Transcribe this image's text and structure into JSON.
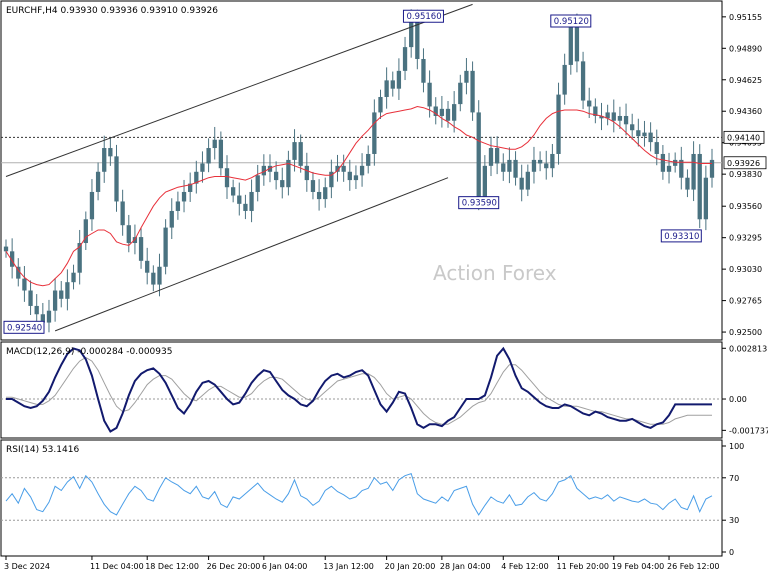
{
  "chart_data": {
    "type": "candlestick",
    "symbol_header": "EURCHF,H4  0.93930 0.93936 0.93910 0.93926",
    "watermark": "Action Forex",
    "current_price_label": "0.93926",
    "resistance_label": "0.94140",
    "price_axis": {
      "ylim": [
        0.9245,
        0.9528
      ],
      "ticks": [
        "0.95155",
        "0.94890",
        "0.94625",
        "0.94360",
        "0.94095",
        "0.93830",
        "0.93560",
        "0.93295",
        "0.93030",
        "0.92765",
        "0.92500"
      ]
    },
    "price_annotations": [
      {
        "label": "0.92540",
        "x": 1,
        "y": 0.9254
      },
      {
        "label": "0.95160",
        "x": 68,
        "y": 0.9516
      },
      {
        "label": "0.93590",
        "x": 77,
        "y": 0.9359
      },
      {
        "label": "0.95120",
        "x": 92,
        "y": 0.9512
      },
      {
        "label": "0.93310",
        "x": 110,
        "y": 0.9331
      }
    ],
    "channel": [
      {
        "name": "upper",
        "from": [
          0,
          0.9381
        ],
        "to": [
          76,
          0.9526
        ]
      },
      {
        "name": "lower",
        "from": [
          8,
          0.9251
        ],
        "to": [
          72,
          0.938
        ]
      }
    ],
    "closes": [
      0.9318,
      0.9305,
      0.9295,
      0.9285,
      0.9272,
      0.9265,
      0.9258,
      0.9268,
      0.9285,
      0.9278,
      0.9292,
      0.93,
      0.9325,
      0.9345,
      0.9368,
      0.9385,
      0.9405,
      0.9398,
      0.936,
      0.934,
      0.9325,
      0.933,
      0.931,
      0.93,
      0.929,
      0.9305,
      0.9338,
      0.9352,
      0.936,
      0.9368,
      0.9375,
      0.9385,
      0.9392,
      0.9405,
      0.9412,
      0.9388,
      0.9372,
      0.9365,
      0.9358,
      0.9352,
      0.9368,
      0.9382,
      0.939,
      0.9385,
      0.9378,
      0.9372,
      0.9395,
      0.941,
      0.939,
      0.9378,
      0.9368,
      0.9362,
      0.9372,
      0.9385,
      0.939,
      0.9385,
      0.9378,
      0.9382,
      0.939,
      0.94,
      0.9435,
      0.9448,
      0.9462,
      0.9455,
      0.947,
      0.949,
      0.9512,
      0.948,
      0.946,
      0.944,
      0.9432,
      0.9438,
      0.9428,
      0.9442,
      0.946,
      0.947,
      0.9435,
      0.9362,
      0.939,
      0.9405,
      0.9392,
      0.9385,
      0.9395,
      0.938,
      0.937,
      0.9385,
      0.9395,
      0.9392,
      0.9388,
      0.94,
      0.945,
      0.9475,
      0.9508,
      0.9478,
      0.9445,
      0.944,
      0.9432,
      0.943,
      0.9435,
      0.9428,
      0.9432,
      0.9425,
      0.942,
      0.9415,
      0.9418,
      0.941,
      0.94,
      0.9385,
      0.939,
      0.9395,
      0.938,
      0.937,
      0.94,
      0.9345,
      0.938,
      0.9395
    ],
    "ma_values": [
      0.9318,
      0.931,
      0.9302,
      0.9296,
      0.9292,
      0.929,
      0.9289,
      0.929,
      0.9295,
      0.93,
      0.9308,
      0.9318,
      0.9322,
      0.933,
      0.9333,
      0.9336,
      0.9336,
      0.9333,
      0.9326,
      0.9324,
      0.9323,
      0.9328,
      0.9338,
      0.9347,
      0.9356,
      0.9363,
      0.9368,
      0.937,
      0.9372,
      0.9373,
      0.9374,
      0.9376,
      0.9378,
      0.938,
      0.9381,
      0.9381,
      0.9381,
      0.938,
      0.9379,
      0.9378,
      0.938,
      0.9383,
      0.9385,
      0.9388,
      0.939,
      0.9391,
      0.9392,
      0.939,
      0.9388,
      0.9386,
      0.9384,
      0.9383,
      0.9382,
      0.9382,
      0.9386,
      0.9393,
      0.9401,
      0.9409,
      0.9415,
      0.942,
      0.9426,
      0.9431,
      0.9434,
      0.9435,
      0.9436,
      0.9437,
      0.9438,
      0.944,
      0.9439,
      0.9437,
      0.9434,
      0.943,
      0.9427,
      0.9423,
      0.942,
      0.9416,
      0.9414,
      0.9411,
      0.9409,
      0.9407,
      0.9406,
      0.9405,
      0.9404,
      0.9404,
      0.9406,
      0.941,
      0.9416,
      0.9424,
      0.943,
      0.9434,
      0.9436,
      0.9437,
      0.9437,
      0.9437,
      0.9436,
      0.9434,
      0.9433,
      0.9432,
      0.943,
      0.9427,
      0.9423,
      0.9418,
      0.9413,
      0.9408,
      0.9403,
      0.9399,
      0.9396,
      0.9395,
      0.9394,
      0.9393,
      0.9393,
      0.9393,
      0.9393,
      0.9392,
      0.9392,
      0.9392
    ],
    "macd": {
      "label": "MACD(12,26,9) -0.000284 -0.000935",
      "ylim": [
        -0.00205,
        0.00305
      ],
      "ticks": [
        "0.002813",
        "0.00",
        "-0.001737"
      ],
      "macd_values": [
        0.0,
        0.0,
        -0.0002,
        -0.0004,
        -0.0005,
        -0.0004,
        -0.0001,
        0.0004,
        0.0012,
        0.0019,
        0.0025,
        0.0028,
        0.0027,
        0.0022,
        0.0013,
        0.0,
        -0.0012,
        -0.0018,
        -0.0016,
        -0.0008,
        0.0002,
        0.001,
        0.0014,
        0.0016,
        0.0017,
        0.0014,
        0.0009,
        0.0002,
        -0.0005,
        -0.0008,
        -0.0003,
        0.0004,
        0.0009,
        0.001,
        0.0008,
        0.0004,
        0.0,
        -0.0003,
        -0.0002,
        0.0003,
        0.0009,
        0.0013,
        0.0016,
        0.0015,
        0.001,
        0.0005,
        0.0002,
        0.0,
        -0.0003,
        -0.0004,
        -0.0001,
        0.0005,
        0.001,
        0.0013,
        0.0014,
        0.0012,
        0.0013,
        0.0015,
        0.0016,
        0.0013,
        0.0005,
        -0.0003,
        -0.0007,
        -0.0002,
        0.0004,
        0.0003,
        -0.0005,
        -0.0014,
        -0.0016,
        -0.0014,
        -0.0014,
        -0.0015,
        -0.0012,
        -0.001,
        -0.0005,
        0.0,
        0.0,
        0.0,
        0.0002,
        0.0012,
        0.0024,
        0.0028,
        0.0022,
        0.0013,
        0.0006,
        0.0004,
        0.0001,
        -0.0002,
        -0.0004,
        -0.0005,
        -0.0005,
        -0.0003,
        -0.0004,
        -0.0006,
        -0.0008,
        -0.0009,
        -0.0007,
        -0.0008,
        -0.001,
        -0.0011,
        -0.0012,
        -0.0012,
        -0.0011,
        -0.0013,
        -0.0015,
        -0.0016,
        -0.0014,
        -0.0013,
        -0.0009,
        -0.0003,
        -0.0003,
        -0.0003,
        -0.0003,
        -0.0003,
        -0.0003,
        -0.0003
      ],
      "signal_values": [
        0.0001,
        0.0001,
        0.0,
        -0.0001,
        -0.0002,
        -0.0003,
        -0.0003,
        -0.0001,
        0.0002,
        0.0007,
        0.0012,
        0.0017,
        0.0021,
        0.0023,
        0.0021,
        0.0016,
        0.0009,
        0.0002,
        -0.0004,
        -0.0007,
        -0.0006,
        -0.0002,
        0.0003,
        0.0008,
        0.0011,
        0.0013,
        0.0013,
        0.0011,
        0.0007,
        0.0003,
        0.0,
        -0.0001,
        0.0002,
        0.0005,
        0.0007,
        0.0007,
        0.0005,
        0.0003,
        0.0001,
        0.0001,
        0.0003,
        0.0007,
        0.001,
        0.0012,
        0.0012,
        0.0011,
        0.0008,
        0.0005,
        0.0002,
        0.0,
        -0.0001,
        0.0001,
        0.0004,
        0.0007,
        0.001,
        0.0011,
        0.0012,
        0.0013,
        0.0014,
        0.0014,
        0.0012,
        0.0008,
        0.0003,
        0.0,
        0.0001,
        0.0002,
        0.0,
        -0.0004,
        -0.0008,
        -0.0011,
        -0.0013,
        -0.0014,
        -0.0014,
        -0.0012,
        -0.001,
        -0.0007,
        -0.0004,
        -0.0002,
        -0.0001,
        0.0003,
        0.0009,
        0.0015,
        0.0019,
        0.0019,
        0.0016,
        0.0012,
        0.0008,
        0.0004,
        0.0001,
        -0.0001,
        -0.0003,
        -0.0004,
        -0.0004,
        -0.0004,
        -0.0005,
        -0.0006,
        -0.0007,
        -0.0007,
        -0.0008,
        -0.0009,
        -0.001,
        -0.0011,
        -0.0011,
        -0.0012,
        -0.0013,
        -0.0014,
        -0.0014,
        -0.0014,
        -0.0013,
        -0.0011,
        -0.001,
        -0.0009,
        -0.0009,
        -0.0009,
        -0.0009,
        -0.0009
      ]
    },
    "rsi": {
      "label": "RSI(14) 53.1416",
      "ylim": [
        0,
        100
      ],
      "ticks": [
        "100",
        "70",
        "30",
        "0"
      ],
      "values": [
        48,
        55,
        46,
        60,
        52,
        40,
        38,
        47,
        62,
        58,
        66,
        71,
        60,
        72,
        66,
        55,
        45,
        38,
        35,
        45,
        55,
        62,
        58,
        50,
        48,
        60,
        70,
        66,
        63,
        58,
        55,
        62,
        52,
        50,
        57,
        45,
        42,
        52,
        50,
        55,
        60,
        65,
        58,
        54,
        50,
        47,
        55,
        68,
        53,
        50,
        44,
        48,
        58,
        62,
        57,
        54,
        50,
        52,
        58,
        60,
        70,
        64,
        66,
        58,
        68,
        72,
        74,
        55,
        50,
        48,
        46,
        52,
        48,
        58,
        60,
        62,
        45,
        35,
        44,
        52,
        48,
        46,
        54,
        44,
        45,
        52,
        56,
        50,
        48,
        55,
        66,
        68,
        72,
        60,
        55,
        50,
        52,
        50,
        54,
        48,
        52,
        50,
        48,
        47,
        50,
        46,
        45,
        40,
        46,
        50,
        42,
        40,
        53,
        38,
        50,
        53
      ]
    },
    "time_labels": [
      {
        "label": "3 Dec 2024",
        "x": 0
      },
      {
        "label": "11 Dec 04:00",
        "x": 14
      },
      {
        "label": "18 Dec 12:00",
        "x": 23
      },
      {
        "label": "26 Dec 20:00",
        "x": 33
      },
      {
        "label": "6 Jan 04:00",
        "x": 42
      },
      {
        "label": "13 Jan 12:00",
        "x": 52
      },
      {
        "label": "20 Jan 20:00",
        "x": 62
      },
      {
        "label": "28 Jan 04:00",
        "x": 71
      },
      {
        "label": "4 Feb 12:00",
        "x": 81
      },
      {
        "label": "11 Feb 20:00",
        "x": 90
      },
      {
        "label": "19 Feb 04:00",
        "x": 99
      },
      {
        "label": "26 Feb 12:00",
        "x": 108
      }
    ],
    "colors": {
      "candle": "#4a7280",
      "ma": "#e8303a",
      "macd": "#121a6e",
      "signal": "#a0a0a0",
      "rsi": "#4a9ee8",
      "label_box": "#1a1a8a",
      "grid": "#9a9a9a"
    }
  }
}
